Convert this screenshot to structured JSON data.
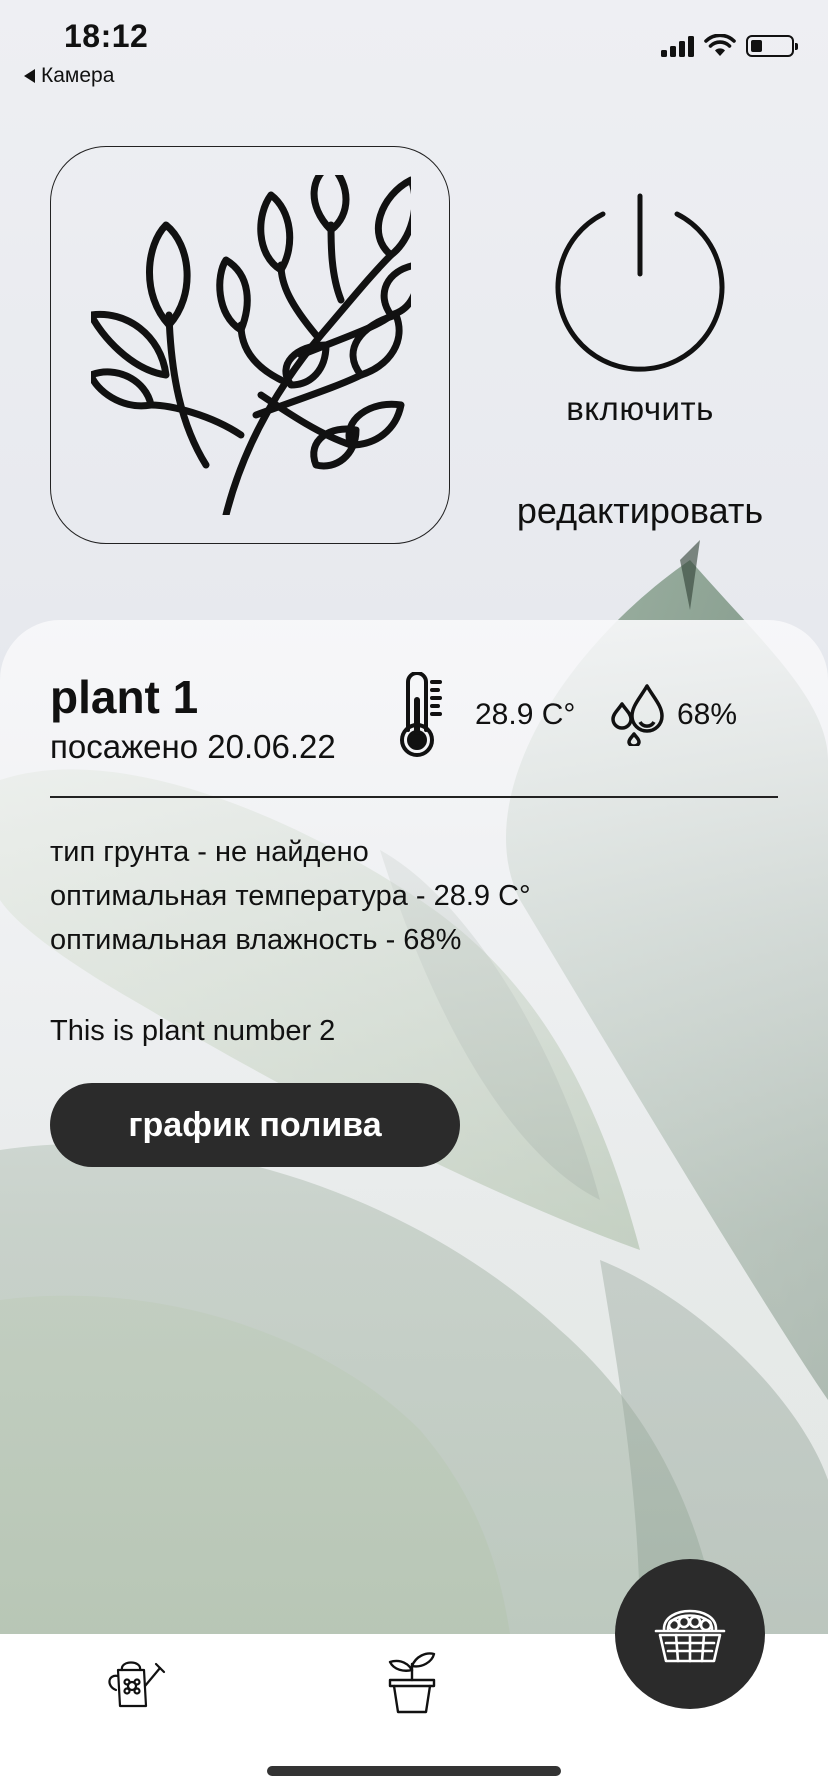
{
  "status_bar": {
    "time": "18:12",
    "back_label": "Камера",
    "battery_level": 0.3
  },
  "header": {
    "power_label": "включить",
    "edit_label": "редактировать"
  },
  "plant": {
    "name": "plant 1",
    "planted_label": "посажено 20.06.22",
    "temperature": "28.9 C°",
    "humidity": "68%",
    "soil_line": "тип грунта - не найдено",
    "opt_temp_line": "оптимальная температура - 28.9 C°",
    "opt_humidity_line": "оптимальная влажность - 68%",
    "description": "This is plant number 2",
    "schedule_button": "график полива"
  },
  "icons": {
    "plant_image": "leaf-branch-icon",
    "power": "power-icon",
    "temperature": "thermometer-icon",
    "humidity": "water-drops-icon",
    "tab_watering": "watering-can-icon",
    "tab_plant": "potted-plant-icon",
    "fab": "basket-icon"
  },
  "colors": {
    "button_dark": "#2b2b2b",
    "tab_bar": "#ffffff"
  }
}
